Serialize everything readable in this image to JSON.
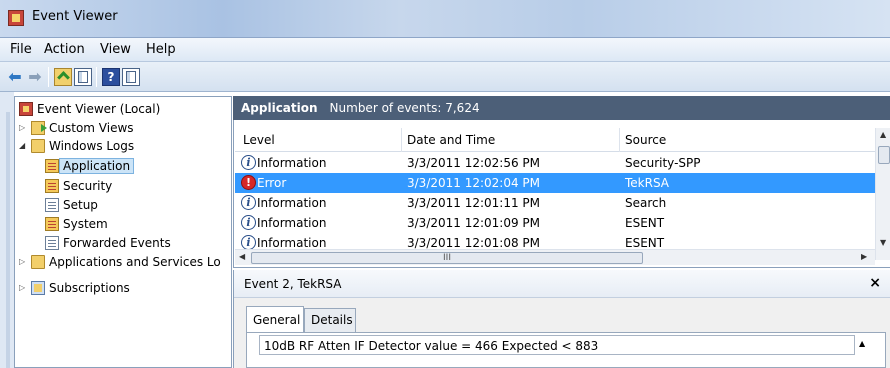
{
  "window": {
    "title": "Event Viewer"
  },
  "menu": {
    "items": [
      "File",
      "Action",
      "View",
      "Help"
    ]
  },
  "toolbar": {
    "icons": [
      "back-arrow-icon",
      "forward-arrow-icon",
      "folder-up-icon",
      "show-hide-pane-icon",
      "help-icon",
      "show-hide-action-pane-icon"
    ]
  },
  "tree": {
    "root": "Event Viewer (Local)",
    "custom_views": "Custom Views",
    "windows_logs": "Windows Logs",
    "application": "Application",
    "security": "Security",
    "setup": "Setup",
    "system": "System",
    "forwarded_events": "Forwarded Events",
    "app_services": "Applications and Services Lo",
    "subscriptions": "Subscriptions"
  },
  "main": {
    "log_name": "Application",
    "event_count": "Number of events: 7,624"
  },
  "events": {
    "columns": {
      "level": "Level",
      "datetime": "Date and Time",
      "source": "Source"
    },
    "rows": [
      {
        "level": "Information",
        "datetime": "3/3/2011 12:02:56 PM",
        "source": "Security-SPP"
      },
      {
        "level": "Error",
        "datetime": "3/3/2011 12:02:04 PM",
        "source": "TekRSA"
      },
      {
        "level": "Information",
        "datetime": "3/3/2011 12:01:11 PM",
        "source": "Search"
      },
      {
        "level": "Information",
        "datetime": "3/3/2011 12:01:09 PM",
        "source": "ESENT"
      },
      {
        "level": "Information",
        "datetime": "3/3/2011 12:01:08 PM",
        "source": "ESENT"
      }
    ],
    "scroll_grip": "III"
  },
  "detail": {
    "title": "Event 2, TekRSA",
    "close_glyph": "×",
    "tabs": [
      "General",
      "Details"
    ],
    "description": "10dB RF Atten IF Detector value = 466  Expected < 883"
  },
  "colors": {
    "selection": "#3399ff",
    "header_bg": "#4c5f78",
    "error_icon": "#d62828"
  }
}
